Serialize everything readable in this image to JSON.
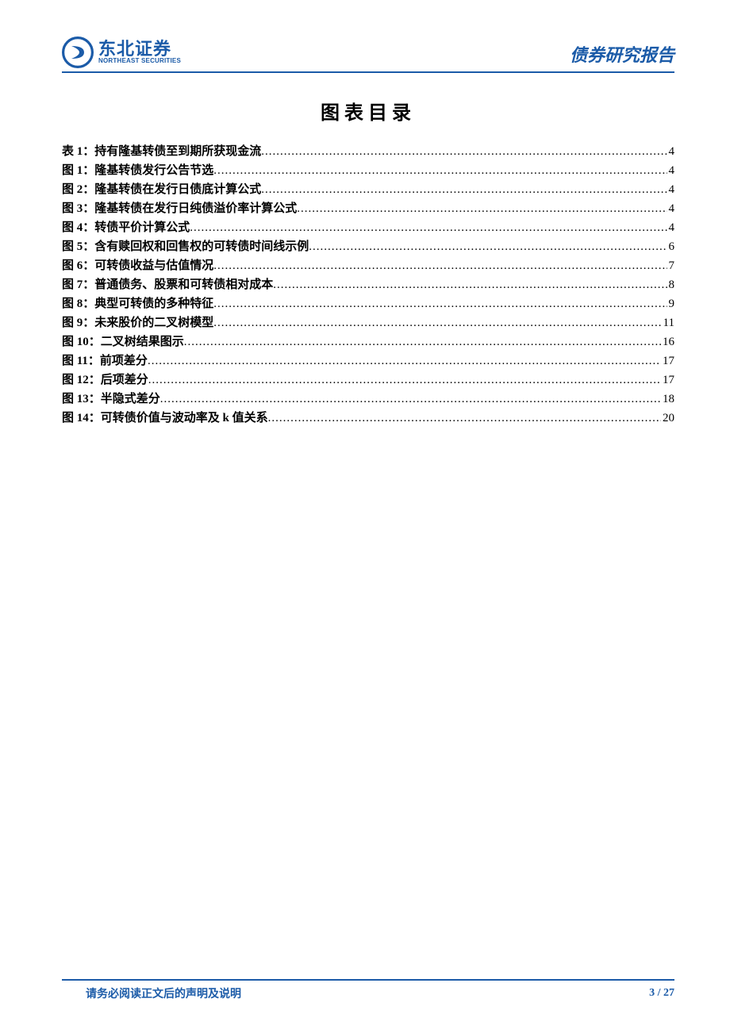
{
  "header": {
    "logo_cn": "东北证券",
    "logo_en": "NORTHEAST SECURITIES",
    "doc_tag": "债券研究报告"
  },
  "title": "图表目录",
  "toc": [
    {
      "label": "表 1：持有隆基转债至到期所获现金流",
      "page": "4"
    },
    {
      "label": "图 1：隆基转债发行公告节选",
      "page": "4"
    },
    {
      "label": "图 2：隆基转债在发行日债底计算公式",
      "page": "4"
    },
    {
      "label": "图 3：隆基转债在发行日纯债溢价率计算公式",
      "page": "4"
    },
    {
      "label": "图 4：转债平价计算公式",
      "page": "4"
    },
    {
      "label": "图 5：含有赎回权和回售权的可转债时间线示例",
      "page": "6"
    },
    {
      "label": "图 6：可转债收益与估值情况",
      "page": "7"
    },
    {
      "label": "图 7：普通债务、股票和可转债相对成本",
      "page": "8"
    },
    {
      "label": "图 8：典型可转债的多种特征",
      "page": "9"
    },
    {
      "label": "图 9：未来股价的二叉树模型",
      "page": "11"
    },
    {
      "label": "图 10：二叉树结果图示",
      "page": "16"
    },
    {
      "label": "图 11：前项差分",
      "page": "17"
    },
    {
      "label": "图 12：后项差分",
      "page": "17"
    },
    {
      "label": "图 13：半隐式差分",
      "page": "18"
    },
    {
      "label": "图 14：可转债价值与波动率及 k 值关系",
      "page": "20"
    }
  ],
  "footer": {
    "note": "请务必阅读正文后的声明及说明",
    "page": "3 / 27"
  }
}
